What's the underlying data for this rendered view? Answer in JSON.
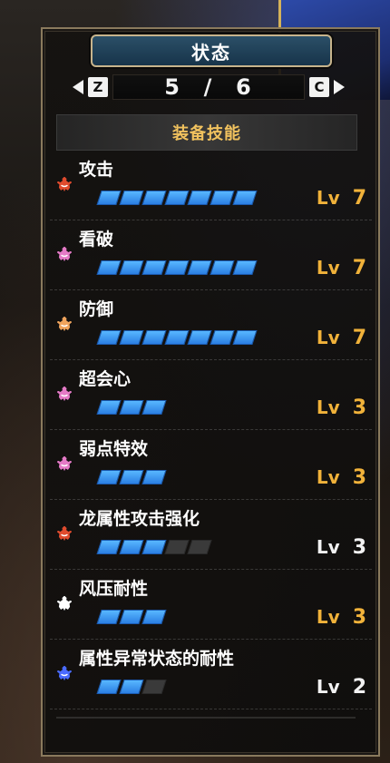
{
  "colors": {
    "accent_gold": "#f1b23a",
    "bar_blue": "#2b7fe3",
    "title_plate": "#17344a"
  },
  "header": {
    "title": "状态",
    "nav_left_key": "Z",
    "nav_right_key": "C",
    "page_current": "5",
    "page_sep": "/",
    "page_total": "6",
    "arrow_left_icon": "arrow-left-icon",
    "arrow_right_icon": "arrow-right-icon"
  },
  "section": {
    "title": "装备技能"
  },
  "lv_label": "Lv",
  "skills": [
    {
      "name": "攻击",
      "level": 7,
      "max": 7,
      "icon": "skill-attack-icon",
      "icon_color": "#e04b2d"
    },
    {
      "name": "看破",
      "level": 7,
      "max": 7,
      "icon": "skill-critical-eye-icon",
      "icon_color": "#e57ac6"
    },
    {
      "name": "防御",
      "level": 7,
      "max": 7,
      "icon": "skill-defense-icon",
      "icon_color": "#f0a45c"
    },
    {
      "name": "超会心",
      "level": 3,
      "max": 3,
      "icon": "skill-critical-boost-icon",
      "icon_color": "#e57ac6"
    },
    {
      "name": "弱点特效",
      "level": 3,
      "max": 3,
      "icon": "skill-weakness-exploit-icon",
      "icon_color": "#e57ac6"
    },
    {
      "name": "龙属性攻击强化",
      "level": 3,
      "max": 5,
      "icon": "skill-dragon-attack-icon",
      "icon_color": "#e04b2d"
    },
    {
      "name": "风压耐性",
      "level": 3,
      "max": 3,
      "icon": "skill-windproof-icon",
      "icon_color": "#ffffff"
    },
    {
      "name": "属性异常状态的耐性",
      "level": 2,
      "max": 3,
      "icon": "skill-status-resistance-icon",
      "icon_color": "#4a6bff"
    }
  ]
}
